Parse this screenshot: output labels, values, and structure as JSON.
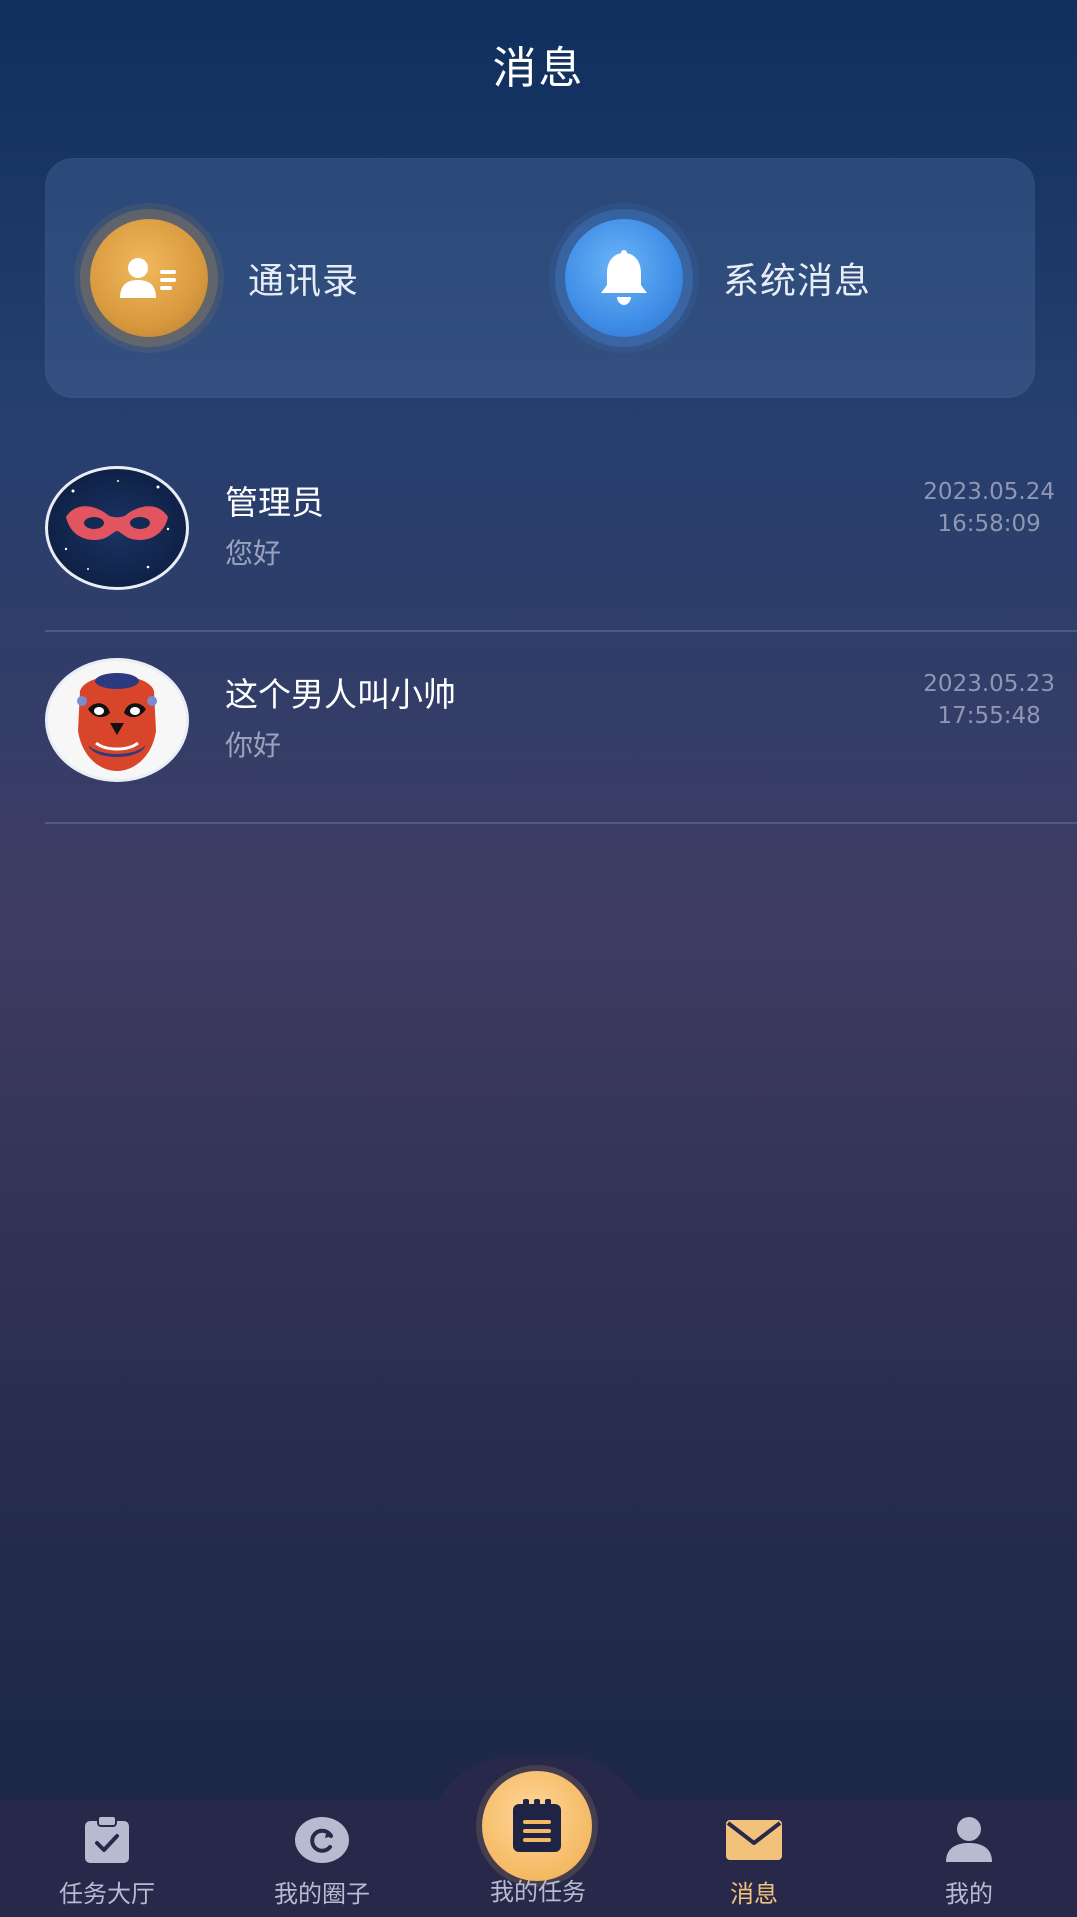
{
  "header": {
    "title": "消息"
  },
  "quick_actions": {
    "contacts": {
      "label": "通讯录",
      "icon": "contact-card-icon",
      "color": "#d99a3f"
    },
    "system": {
      "label": "系统消息",
      "icon": "bell-icon",
      "color": "#3f8de6"
    }
  },
  "conversations": [
    {
      "name": "管理员",
      "preview": "您好",
      "date": "2023.05.24",
      "time": "16:58:09",
      "avatar": "red-mask-avatar"
    },
    {
      "name": "这个男人叫小帅",
      "preview": "你好",
      "date": "2023.05.23",
      "time": "17:55:48",
      "avatar": "opera-face-avatar"
    }
  ],
  "bottom_nav": {
    "items": [
      {
        "label": "任务大厅",
        "icon": "clipboard-check-icon"
      },
      {
        "label": "我的圈子",
        "icon": "refresh-circle-icon"
      },
      {
        "label": "我的任务",
        "icon": "notepad-icon"
      },
      {
        "label": "消息",
        "icon": "mail-icon",
        "active": true
      },
      {
        "label": "我的",
        "icon": "user-icon"
      }
    ],
    "active_color": "#f2c27a"
  }
}
